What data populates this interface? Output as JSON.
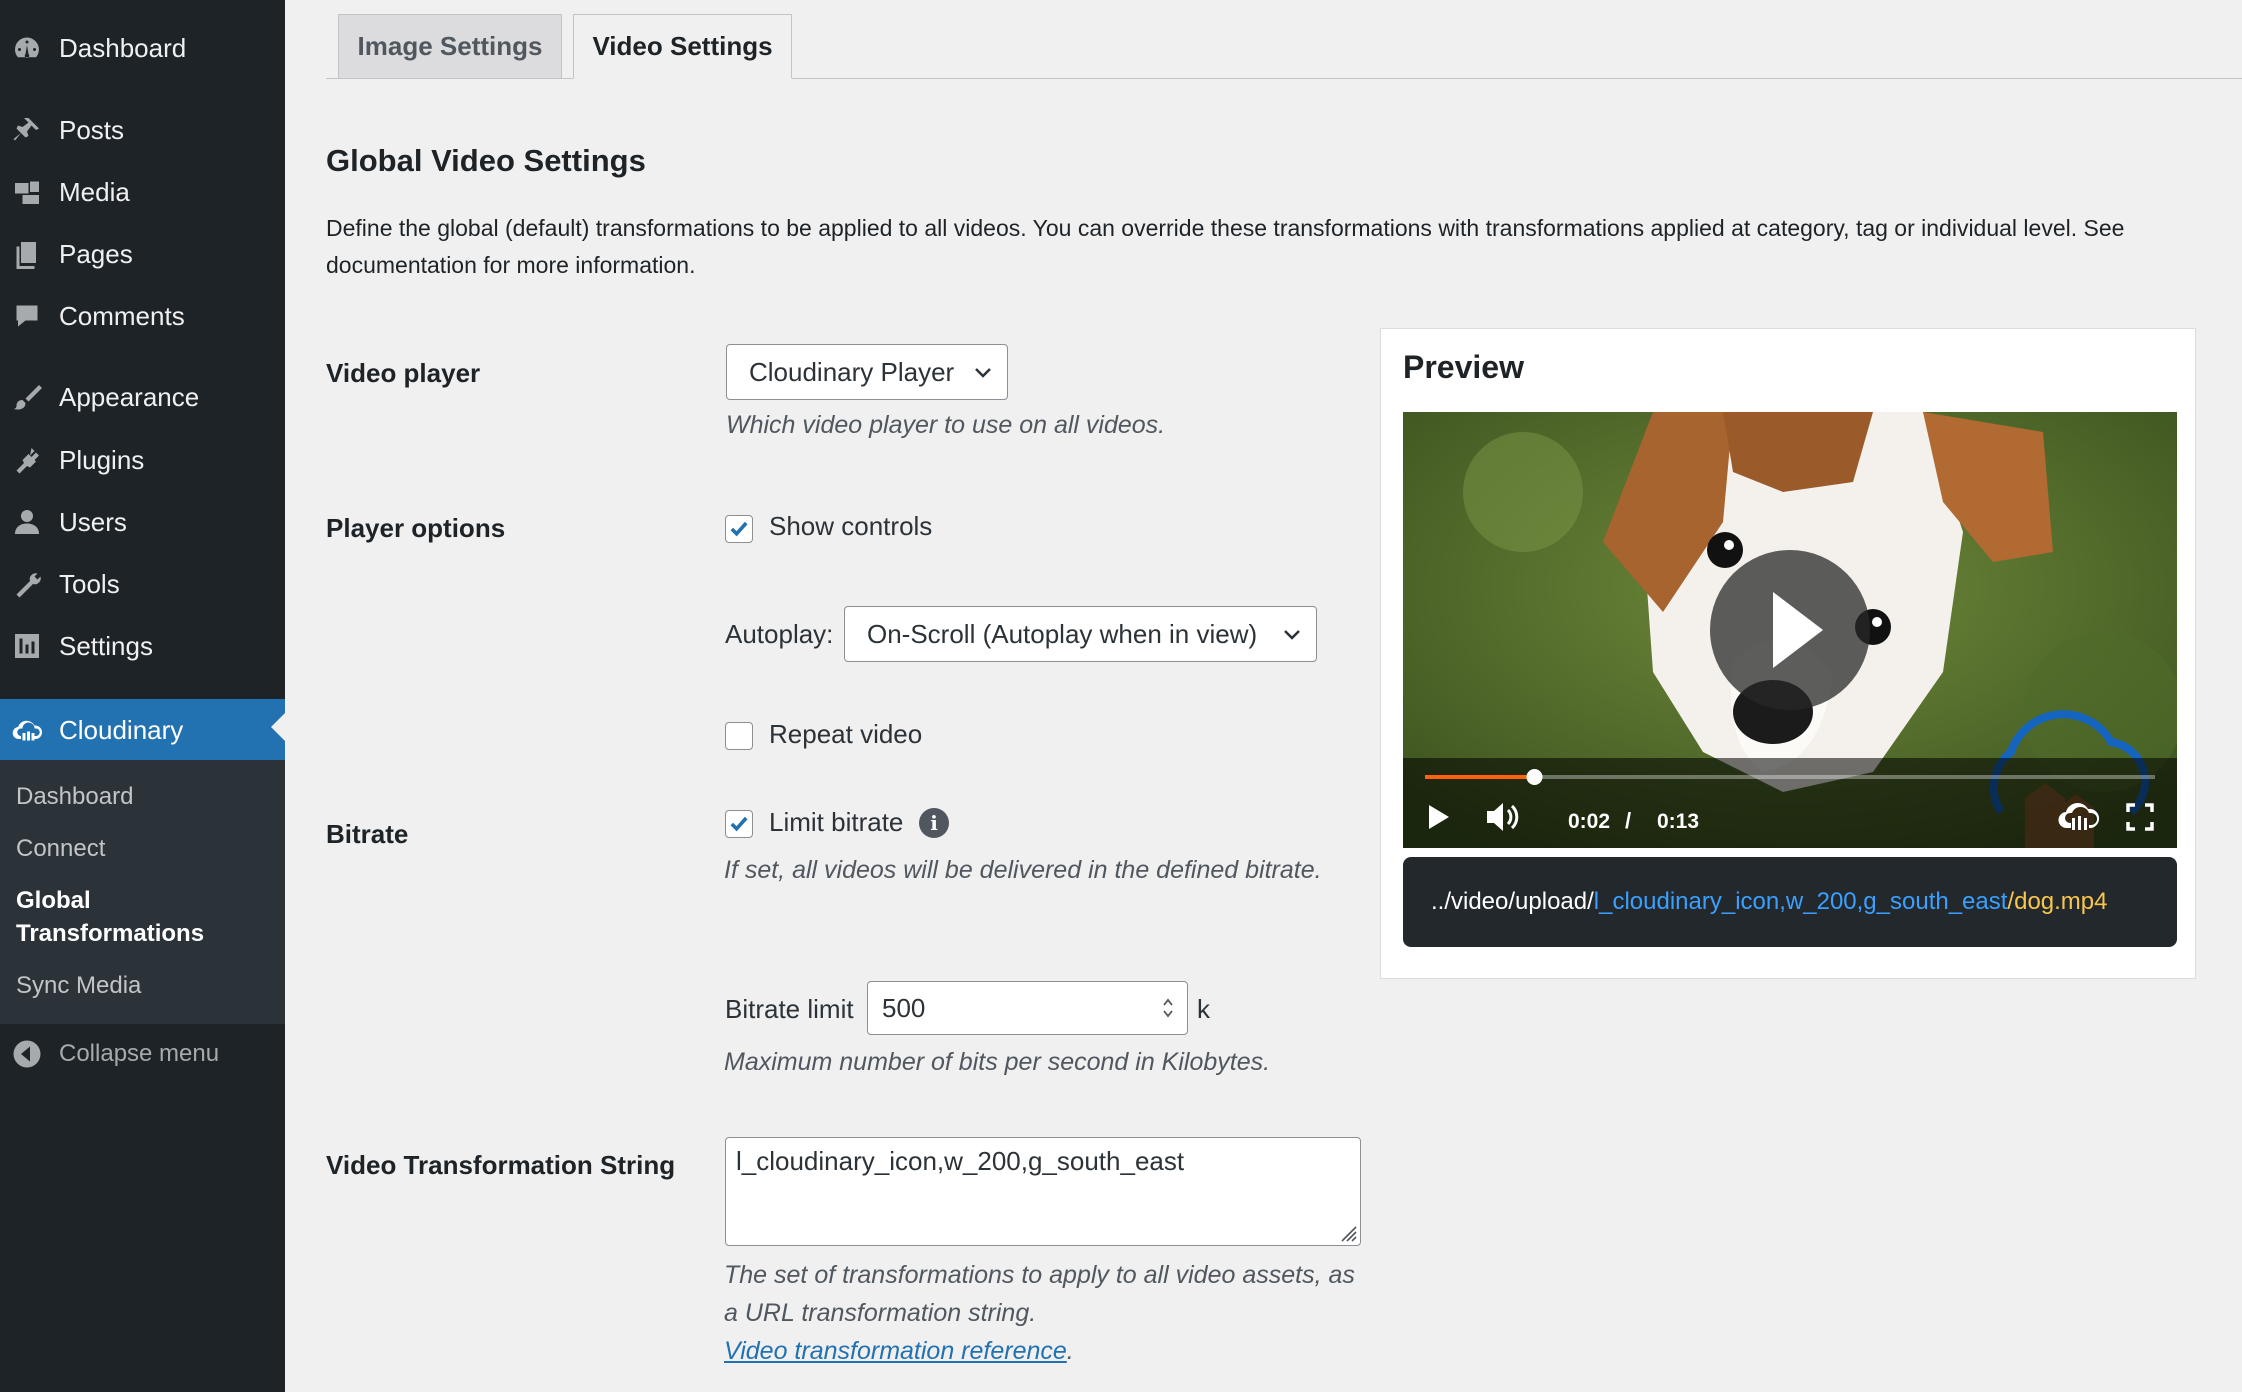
{
  "sidebar": {
    "items": [
      {
        "label": "Dashboard",
        "icon": "dashboard-icon"
      },
      {
        "label": "Posts",
        "icon": "pin-icon"
      },
      {
        "label": "Media",
        "icon": "media-icon"
      },
      {
        "label": "Pages",
        "icon": "pages-icon"
      },
      {
        "label": "Comments",
        "icon": "comment-icon"
      },
      {
        "label": "Appearance",
        "icon": "brush-icon"
      },
      {
        "label": "Plugins",
        "icon": "plug-icon"
      },
      {
        "label": "Users",
        "icon": "user-icon"
      },
      {
        "label": "Tools",
        "icon": "wrench-icon"
      },
      {
        "label": "Settings",
        "icon": "settings-icon"
      },
      {
        "label": "Cloudinary",
        "icon": "cloudinary-icon"
      }
    ],
    "submenu": [
      {
        "label": "Dashboard"
      },
      {
        "label": "Connect"
      },
      {
        "label": "Global Transformations"
      },
      {
        "label": "Sync Media"
      }
    ],
    "collapse_label": "Collapse menu"
  },
  "tabs": [
    {
      "label": "Image Settings",
      "active": false
    },
    {
      "label": "Video Settings",
      "active": true
    }
  ],
  "section": {
    "title": "Global Video Settings",
    "description": "Define the global (default) transformations to be applied to all videos. You can override these transformations with transformations applied at category, tag or individual level. See documentation for more information."
  },
  "video_player": {
    "label": "Video player",
    "selected": "Cloudinary Player",
    "hint": "Which video player to use on all videos."
  },
  "player_options": {
    "label": "Player options",
    "show_controls_label": "Show controls",
    "show_controls_checked": true,
    "autoplay_label": "Autoplay:",
    "autoplay_selected": "On-Scroll (Autoplay when in view)",
    "repeat_label": "Repeat video",
    "repeat_checked": false
  },
  "bitrate": {
    "label": "Bitrate",
    "limit_label": "Limit bitrate",
    "limit_checked": true,
    "limit_hint": "If set, all videos will be delivered in the defined bitrate.",
    "limit_value_label": "Bitrate limit",
    "limit_value": "500",
    "unit": "k",
    "value_hint": "Maximum number of bits per second in Kilobytes."
  },
  "transformation": {
    "label": "Video Transformation String",
    "value": "l_cloudinary_icon,w_200,g_south_east",
    "hint": "The set of transformations to apply to all video assets, as a URL transformation string.",
    "link_text": "Video transformation reference",
    "link_suffix": "."
  },
  "preview": {
    "title": "Preview",
    "time_current": "0:02",
    "time_separator": "/",
    "time_duration": "0:13",
    "progress": 0.15,
    "url_base": "../video/upload/",
    "url_transformation": "l_cloudinary_icon,w_200,g_south_east",
    "url_file": "/dog.mp4"
  },
  "colors": {
    "sidebar_bg": "#1d2327",
    "accent": "#2271b1",
    "progress": "#ff620c",
    "url_transform": "#3aa0ff",
    "url_file": "#f8c64b"
  }
}
